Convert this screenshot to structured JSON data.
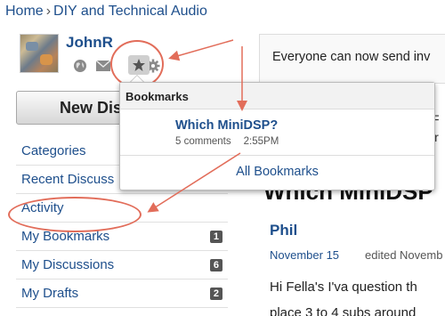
{
  "breadcrumb": {
    "home": "Home",
    "separator": "›",
    "category": "DIY and Technical Audio"
  },
  "user": {
    "name": "JohnR"
  },
  "user_icons": [
    "globe-icon",
    "envelope-icon",
    "star-icon",
    "gear-icon"
  ],
  "announcement": {
    "text": "Everyone can now send inv"
  },
  "new_discussion": {
    "label": "New Dis"
  },
  "sidebar": {
    "items": [
      {
        "label": "Categories",
        "count": ""
      },
      {
        "label": "Recent Discuss",
        "count": ""
      },
      {
        "label": "Activity",
        "count": ""
      },
      {
        "label": "My Bookmarks",
        "count": "1"
      },
      {
        "label": "My Discussions",
        "count": "6"
      },
      {
        "label": "My Drafts",
        "count": "2"
      }
    ]
  },
  "bookmarks_popup": {
    "header": "Bookmarks",
    "items": [
      {
        "title": "Which MiniDSP?",
        "comments": "5 comments",
        "time": "2:55PM"
      }
    ],
    "footer": "All Bookmarks"
  },
  "discussion": {
    "title": "Which MiniDSP",
    "author": "Phil",
    "date": "November 15",
    "edited": "edited Novemb",
    "body_line1": "Hi Fella's I'va question th",
    "body_line2": "place 3 to 4 subs around"
  },
  "right_partial": {
    "line1": "F",
    "line2": "ir"
  },
  "colors": {
    "link": "#1e4f8c",
    "annotation": "#e26d5a",
    "badge": "#555555"
  }
}
